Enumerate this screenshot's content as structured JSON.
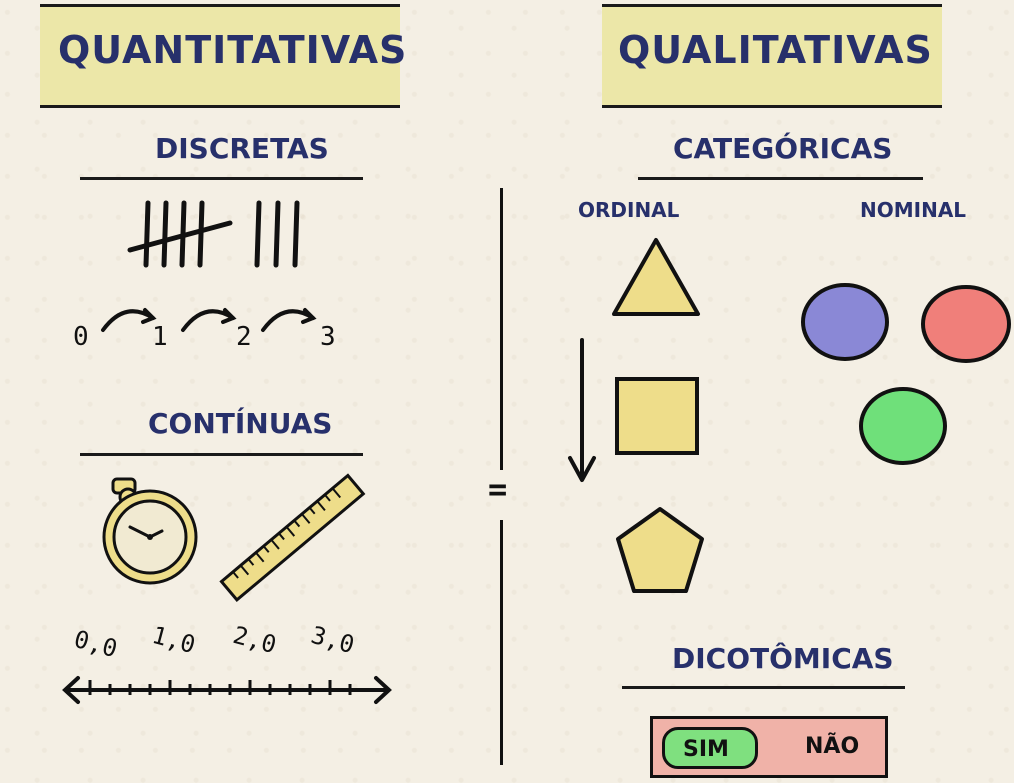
{
  "left": {
    "title": "QUANTITATIVAS",
    "discrete_heading": "DISCRETAS",
    "counting_numbers": [
      "0",
      "1",
      "2",
      "3"
    ],
    "continuous_heading": "CONTÍNUAS",
    "number_line_labels": [
      "0,0",
      "1,0",
      "2,0",
      "3,0"
    ]
  },
  "right": {
    "title": "QUALITATIVAS",
    "categorical_heading": "CATEGÓRICAS",
    "ordinal_label": "ORDINAL",
    "nominal_label": "NOMINAL",
    "dichotomous_heading": "DICOTÔMICAS",
    "toggle": {
      "yes": "SIM",
      "no": "NÃO"
    }
  },
  "separator_symbol": "=",
  "colors": {
    "ink_blue": "#27306b",
    "title_bg": "#ece7a8",
    "shape_yellow": "#eedd8a",
    "circle_blue": "#8a88d6",
    "circle_red": "#f07f7a",
    "circle_green": "#6fe07a",
    "toggle_bg": "#f0b2a8",
    "toggle_yes_bg": "#7fe07f"
  },
  "icons": [
    "tally-marks-icon",
    "stopwatch-icon",
    "ruler-icon",
    "triangle-icon",
    "square-icon",
    "pentagon-icon",
    "down-arrow-icon"
  ]
}
